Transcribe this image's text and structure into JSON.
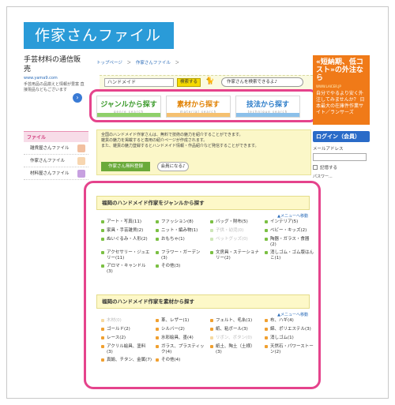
{
  "banner": {
    "title": "作家さんファイル"
  },
  "ad_left": {
    "title": "手芸材料の通信販売",
    "url": "www.yama9.com",
    "desc": "手芸用品の品揃えと情報が豊富 直接現品などもございます"
  },
  "breadcrumb": {
    "top": "トップページ",
    "sep": "＞",
    "current": "作家さんファイル",
    "end": "＞"
  },
  "search": {
    "value": "ハンドメイド",
    "button": "検索する",
    "bubble": "作家さんを検索できるよ♪"
  },
  "tabs": [
    {
      "label": "ジャンルから探す",
      "sub": "genre search"
    },
    {
      "label": "素材から探す",
      "sub": "material search"
    },
    {
      "label": "技法から探す",
      "sub": "technique search"
    }
  ],
  "sidebar": {
    "heading": "ファイル",
    "items": [
      {
        "label": "雑貨屋さんファイル"
      },
      {
        "label": "作家さんファイル"
      },
      {
        "label": "材料屋さんファイル"
      }
    ]
  },
  "intro": {
    "line1": "全国のハンドメイド作家さんは、無料で技術の魅力を紹介することができます。",
    "line2": "雑貨の魅力を掲載すると専用の紹介ページが作成されます。",
    "line3": "また、雑貨の魅力登録するとハンドメイド情報・作品紹介など発信することができます。",
    "register": "作家さん無料登録",
    "member": "会員になる♪"
  },
  "ad_right": {
    "headline": "«短納期、低コスト»の外注なら",
    "site": "WWW.LAICER.JP",
    "desc": "自分でやるより安く外注してみませんか？ 日本最大の在庫件作業サイト／ランサーズ"
  },
  "login": {
    "heading": "ログイン（会員）",
    "email_label": "メールアドレス",
    "remember": "記憶する",
    "cut": "パスワー..."
  },
  "genre_section": {
    "title": "福岡のハンドメイド作家をジャンルから探す",
    "menu_link": "▲メニューへ移動",
    "items": [
      {
        "label": "アート・写真(11)",
        "dim": false,
        "color": "#7bc043"
      },
      {
        "label": "ファッション(8)",
        "dim": false,
        "color": "#7bc043"
      },
      {
        "label": "バッグ・財布(5)",
        "dim": false,
        "color": "#7bc043"
      },
      {
        "label": "インテリア(5)",
        "dim": false,
        "color": "#7bc043"
      },
      {
        "label": "家具・手芸雑貨(2)",
        "dim": false,
        "color": "#7bc043"
      },
      {
        "label": "ニット・編み物(1)",
        "dim": false,
        "color": "#7bc043"
      },
      {
        "label": "子供・幼児(0)",
        "dim": true,
        "color": "#cde6b8"
      },
      {
        "label": "ベビー・キッズ(2)",
        "dim": false,
        "color": "#7bc043"
      },
      {
        "label": "ぬいぐるみ・人形(2)",
        "dim": false,
        "color": "#7bc043"
      },
      {
        "label": "おもちゃ(1)",
        "dim": false,
        "color": "#7bc043"
      },
      {
        "label": "ペットグッズ(0)",
        "dim": true,
        "color": "#cde6b8"
      },
      {
        "label": "陶器・ガラス・食器(2)",
        "dim": false,
        "color": "#7bc043"
      },
      {
        "label": "アクセサリー・ジュエリー(11)",
        "dim": false,
        "color": "#7bc043"
      },
      {
        "label": "フラワー・ガーデン(3)",
        "dim": false,
        "color": "#7bc043"
      },
      {
        "label": "文房具・ステーショナリー(2)",
        "dim": false,
        "color": "#7bc043"
      },
      {
        "label": "消しゴム・ゴム版はんこ(1)",
        "dim": false,
        "color": "#7bc043"
      },
      {
        "label": "アロマ・キャンドル(3)",
        "dim": false,
        "color": "#7bc043"
      },
      {
        "label": "その他(3)",
        "dim": false,
        "color": "#7bc043"
      }
    ]
  },
  "material_section": {
    "title": "福岡のハンドメイド作家を素材から探す",
    "menu_link": "▲メニューへ移動",
    "items": [
      {
        "label": "木材(0)",
        "dim": true,
        "color": "#f5d9a0"
      },
      {
        "label": "革、レザー(1)",
        "dim": false,
        "color": "#f0a030"
      },
      {
        "label": "フェルト、毛糸(1)",
        "dim": false,
        "color": "#f0a030"
      },
      {
        "label": "布、ハギ(4)",
        "dim": false,
        "color": "#f0a030"
      },
      {
        "label": "ゴールド(2)",
        "dim": false,
        "color": "#f0a030"
      },
      {
        "label": "シルバー(2)",
        "dim": false,
        "color": "#f0a030"
      },
      {
        "label": "紙、粘ボール(3)",
        "dim": false,
        "color": "#f0a030"
      },
      {
        "label": "綿、ポリエステル(3)",
        "dim": false,
        "color": "#f0a030"
      },
      {
        "label": "レース(2)",
        "dim": false,
        "color": "#f0a030"
      },
      {
        "label": "水彩絵具、墨(4)",
        "dim": false,
        "color": "#f0a030"
      },
      {
        "label": "リボン、ボタン(0)",
        "dim": true,
        "color": "#f5d9a0"
      },
      {
        "label": "消しゴム(1)",
        "dim": false,
        "color": "#f0a030"
      },
      {
        "label": "アクリル絵具、塗料(3)",
        "dim": false,
        "color": "#f0a030"
      },
      {
        "label": "ガラス、プラスティック(4)",
        "dim": false,
        "color": "#f0a030"
      },
      {
        "label": "紙土、陶土（土様）(3)",
        "dim": false,
        "color": "#f0a030"
      },
      {
        "label": "天然石・パワーストーン(2)",
        "dim": false,
        "color": "#f0a030"
      },
      {
        "label": "真鍮、チタン、金属(7)",
        "dim": false,
        "color": "#f0a030"
      },
      {
        "label": "その他(4)",
        "dim": false,
        "color": "#f0a030"
      }
    ]
  }
}
